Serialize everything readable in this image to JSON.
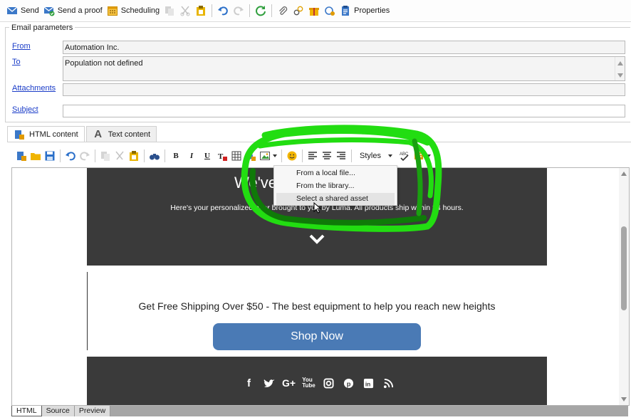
{
  "toolbar": {
    "send": "Send",
    "send_proof": "Send a proof",
    "scheduling": "Scheduling",
    "properties": "Properties"
  },
  "email_params": {
    "legend": "Email parameters",
    "from_label": "From",
    "from_value": "Automation Inc.",
    "to_label": "To",
    "to_value": "Population not defined",
    "attachments_label": "Attachments",
    "attachments_value": "",
    "subject_label": "Subject",
    "subject_value": ""
  },
  "content_tabs": [
    {
      "label": "HTML content",
      "icon": "html-content-icon",
      "active": true
    },
    {
      "label": "Text content",
      "icon": "text-content-icon",
      "active": false
    }
  ],
  "editor_toolbar": {
    "bold": "B",
    "italic": "I",
    "underline": "U",
    "styles": "Styles"
  },
  "image_menu": {
    "items": [
      {
        "label": "From a local file..."
      },
      {
        "label": "From the library..."
      },
      {
        "label": "Select a shared asset",
        "highlighted": true
      }
    ]
  },
  "email_preview": {
    "hero_title": "We've",
    "hero_sub": "Here's your personalized offer brought to you by Luma. All products ship within 24 hours.",
    "promo_text": "Get Free Shipping Over $50 - The best equipment to help you reach new heights",
    "shop_button": "Shop Now",
    "social_icons": [
      "facebook-icon",
      "twitter-icon",
      "google-plus-icon",
      "youtube-icon",
      "instagram-icon",
      "pinterest-icon",
      "linkedin-icon",
      "rss-icon"
    ]
  },
  "bottom_tabs": [
    {
      "label": "HTML",
      "active": true
    },
    {
      "label": "Source",
      "active": false
    },
    {
      "label": "Preview",
      "active": false
    }
  ],
  "colors": {
    "link": "#1a3cc8",
    "hero_bg": "#3a3a3a",
    "button_bg": "#4a7ab5",
    "annotation": "#22dd11"
  }
}
